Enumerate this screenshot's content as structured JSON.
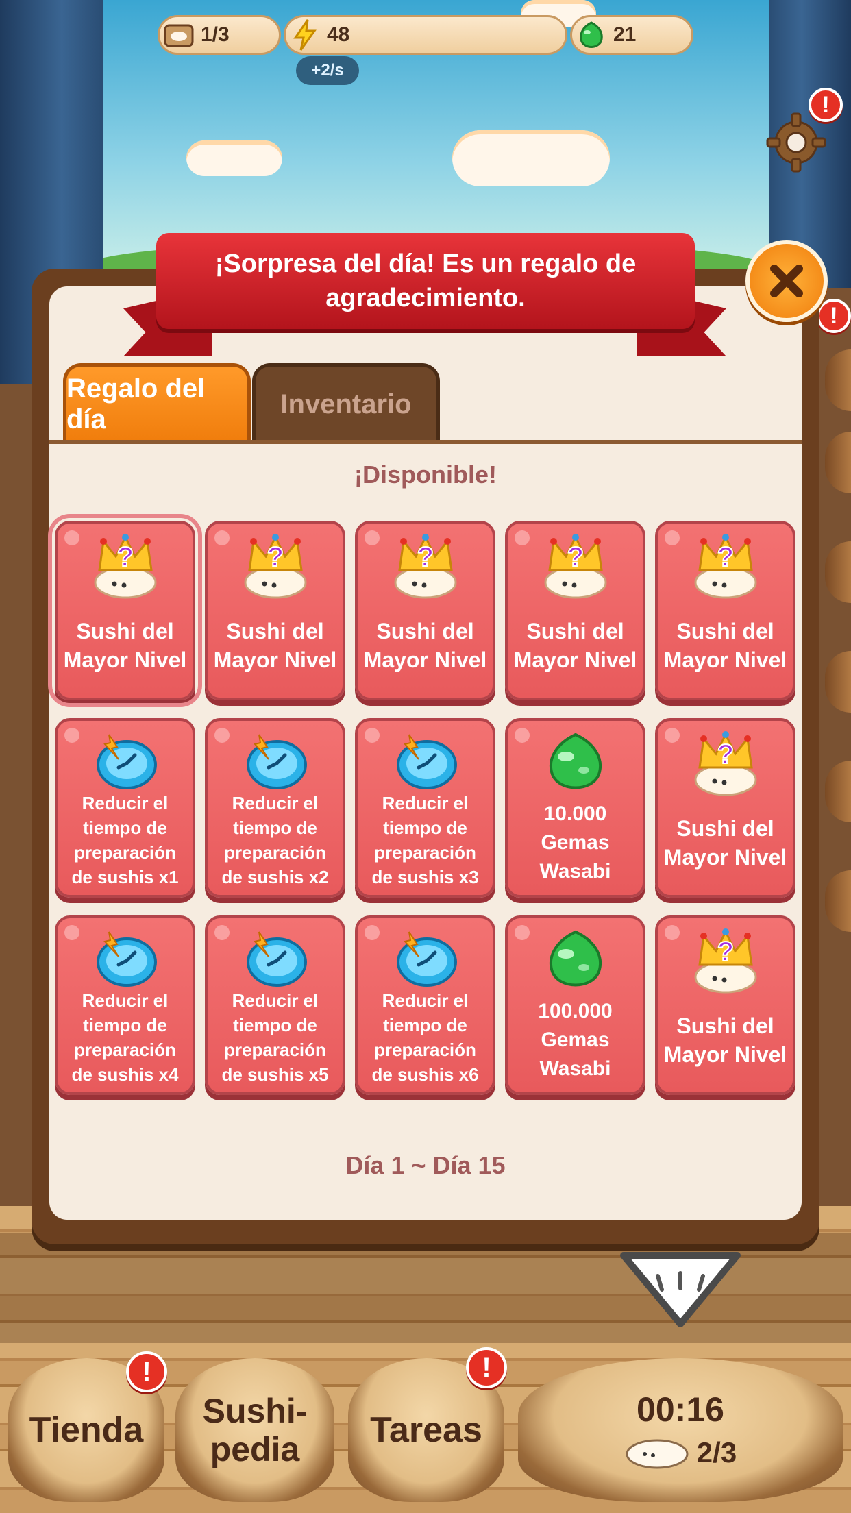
{
  "resources": {
    "plates": "1/3",
    "energy": "48",
    "energy_rate": "+2/s",
    "gems": "21"
  },
  "ribbon": {
    "line1": "¡Sorpresa del día! Es un regalo de",
    "line2": "agradecimiento."
  },
  "tabs": {
    "daily": "Regalo del día",
    "inventory": "Inventario"
  },
  "status": "¡Disponible!",
  "rewards": [
    {
      "type": "sushi",
      "label": "Sushi del Mayor Nivel"
    },
    {
      "type": "sushi",
      "label": "Sushi del Mayor Nivel"
    },
    {
      "type": "sushi",
      "label": "Sushi del Mayor Nivel"
    },
    {
      "type": "sushi",
      "label": "Sushi del Mayor Nivel"
    },
    {
      "type": "sushi",
      "label": "Sushi del Mayor Nivel"
    },
    {
      "type": "clock",
      "label": "Reducir el tiempo de preparación de sushis x1"
    },
    {
      "type": "clock",
      "label": "Reducir el tiempo de preparación de sushis x2"
    },
    {
      "type": "clock",
      "label": "Reducir el tiempo de preparación de sushis x3"
    },
    {
      "type": "gem",
      "label": "10.000 Gemas Wasabi"
    },
    {
      "type": "sushi",
      "label": "Sushi del Mayor Nivel"
    },
    {
      "type": "clock",
      "label": "Reducir el tiempo de preparación de sushis x4"
    },
    {
      "type": "clock",
      "label": "Reducir el tiempo de preparación de sushis x5"
    },
    {
      "type": "clock",
      "label": "Reducir el tiempo de preparación de sushis x6"
    },
    {
      "type": "gem",
      "label": "100.000 Gemas Wasabi"
    },
    {
      "type": "sushi",
      "label": "Sushi del Mayor Nivel"
    }
  ],
  "day_range": "Día 1 ~ Día 15",
  "nav": {
    "shop": "Tienda",
    "sushipedia_1": "Sushi-",
    "sushipedia_2": "pedia",
    "tasks": "Tareas",
    "timer": "00:16",
    "capacity": "2/3"
  },
  "alert_mark": "!",
  "colors": {
    "card": "#e85a5c",
    "tab_active": "#f07d0c",
    "ribbon": "#c8161e",
    "alert": "#e53024"
  }
}
